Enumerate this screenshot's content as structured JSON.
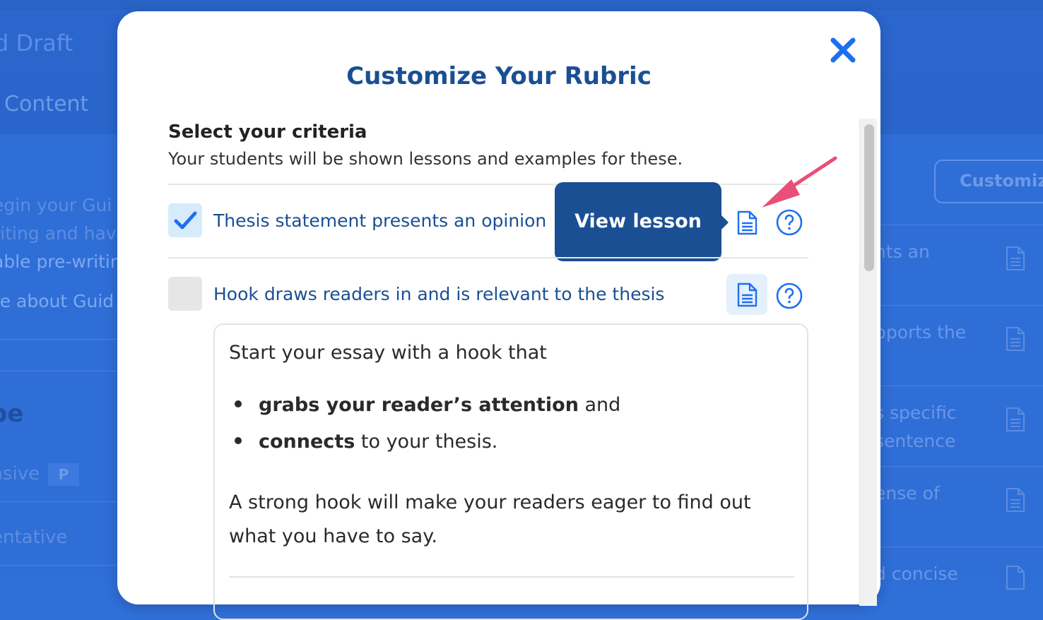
{
  "background": {
    "header_title": "d Draft",
    "tab_label": "Content",
    "left_lines": [
      {
        "text": "egin your Gui",
        "link": false
      },
      {
        "text": "riting and hav",
        "link": false
      },
      {
        "text": "able pre-writin",
        "link": true
      },
      {
        "text": "re about Guid",
        "link": true
      }
    ],
    "big_heading": "pe",
    "side_items": [
      "asive",
      "entative"
    ],
    "pill_letter": "P",
    "customize_button": "Customiz",
    "right_lines": [
      "nts an",
      "pports the",
      "s specific",
      "sentence",
      "ense of",
      "d concise"
    ]
  },
  "modal": {
    "title": "Customize Your Rubric",
    "close_icon": "close-icon",
    "section_label": "Select your criteria",
    "section_desc": "Your students will be shown lessons and examples for these.",
    "criteria": [
      {
        "label": "Thesis statement presents an opinion",
        "checked": true
      },
      {
        "label": "Hook draws readers in and is relevant to the thesis",
        "checked": false
      }
    ],
    "tooltip": "View lesson",
    "detail": {
      "intro": "Start your essay with a hook that",
      "bullets": [
        {
          "bold": "grabs your reader’s attention",
          "rest": " and"
        },
        {
          "bold": "connects",
          "rest": " to your thesis."
        }
      ],
      "paragraph": "A strong hook will make your readers eager to find out what you have to say."
    }
  },
  "colors": {
    "accent": "#1b4f93",
    "link_blue": "#2f6fd8",
    "annotation_arrow": "#ea4f78"
  }
}
